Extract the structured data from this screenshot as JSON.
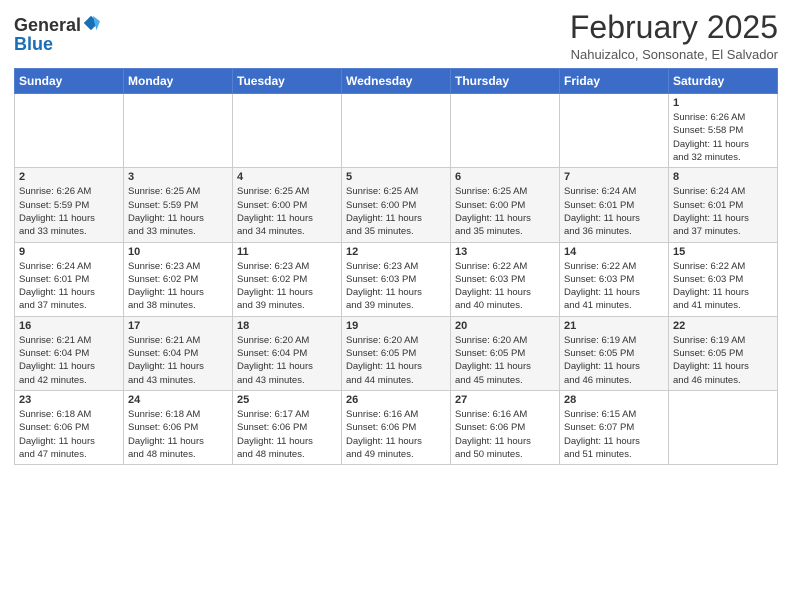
{
  "header": {
    "logo_general": "General",
    "logo_blue": "Blue",
    "month_title": "February 2025",
    "location": "Nahuizalco, Sonsonate, El Salvador"
  },
  "weekdays": [
    "Sunday",
    "Monday",
    "Tuesday",
    "Wednesday",
    "Thursday",
    "Friday",
    "Saturday"
  ],
  "weeks": [
    [
      {
        "day": "",
        "info": ""
      },
      {
        "day": "",
        "info": ""
      },
      {
        "day": "",
        "info": ""
      },
      {
        "day": "",
        "info": ""
      },
      {
        "day": "",
        "info": ""
      },
      {
        "day": "",
        "info": ""
      },
      {
        "day": "1",
        "info": "Sunrise: 6:26 AM\nSunset: 5:58 PM\nDaylight: 11 hours\nand 32 minutes."
      }
    ],
    [
      {
        "day": "2",
        "info": "Sunrise: 6:26 AM\nSunset: 5:59 PM\nDaylight: 11 hours\nand 33 minutes."
      },
      {
        "day": "3",
        "info": "Sunrise: 6:25 AM\nSunset: 5:59 PM\nDaylight: 11 hours\nand 33 minutes."
      },
      {
        "day": "4",
        "info": "Sunrise: 6:25 AM\nSunset: 6:00 PM\nDaylight: 11 hours\nand 34 minutes."
      },
      {
        "day": "5",
        "info": "Sunrise: 6:25 AM\nSunset: 6:00 PM\nDaylight: 11 hours\nand 35 minutes."
      },
      {
        "day": "6",
        "info": "Sunrise: 6:25 AM\nSunset: 6:00 PM\nDaylight: 11 hours\nand 35 minutes."
      },
      {
        "day": "7",
        "info": "Sunrise: 6:24 AM\nSunset: 6:01 PM\nDaylight: 11 hours\nand 36 minutes."
      },
      {
        "day": "8",
        "info": "Sunrise: 6:24 AM\nSunset: 6:01 PM\nDaylight: 11 hours\nand 37 minutes."
      }
    ],
    [
      {
        "day": "9",
        "info": "Sunrise: 6:24 AM\nSunset: 6:01 PM\nDaylight: 11 hours\nand 37 minutes."
      },
      {
        "day": "10",
        "info": "Sunrise: 6:23 AM\nSunset: 6:02 PM\nDaylight: 11 hours\nand 38 minutes."
      },
      {
        "day": "11",
        "info": "Sunrise: 6:23 AM\nSunset: 6:02 PM\nDaylight: 11 hours\nand 39 minutes."
      },
      {
        "day": "12",
        "info": "Sunrise: 6:23 AM\nSunset: 6:03 PM\nDaylight: 11 hours\nand 39 minutes."
      },
      {
        "day": "13",
        "info": "Sunrise: 6:22 AM\nSunset: 6:03 PM\nDaylight: 11 hours\nand 40 minutes."
      },
      {
        "day": "14",
        "info": "Sunrise: 6:22 AM\nSunset: 6:03 PM\nDaylight: 11 hours\nand 41 minutes."
      },
      {
        "day": "15",
        "info": "Sunrise: 6:22 AM\nSunset: 6:03 PM\nDaylight: 11 hours\nand 41 minutes."
      }
    ],
    [
      {
        "day": "16",
        "info": "Sunrise: 6:21 AM\nSunset: 6:04 PM\nDaylight: 11 hours\nand 42 minutes."
      },
      {
        "day": "17",
        "info": "Sunrise: 6:21 AM\nSunset: 6:04 PM\nDaylight: 11 hours\nand 43 minutes."
      },
      {
        "day": "18",
        "info": "Sunrise: 6:20 AM\nSunset: 6:04 PM\nDaylight: 11 hours\nand 43 minutes."
      },
      {
        "day": "19",
        "info": "Sunrise: 6:20 AM\nSunset: 6:05 PM\nDaylight: 11 hours\nand 44 minutes."
      },
      {
        "day": "20",
        "info": "Sunrise: 6:20 AM\nSunset: 6:05 PM\nDaylight: 11 hours\nand 45 minutes."
      },
      {
        "day": "21",
        "info": "Sunrise: 6:19 AM\nSunset: 6:05 PM\nDaylight: 11 hours\nand 46 minutes."
      },
      {
        "day": "22",
        "info": "Sunrise: 6:19 AM\nSunset: 6:05 PM\nDaylight: 11 hours\nand 46 minutes."
      }
    ],
    [
      {
        "day": "23",
        "info": "Sunrise: 6:18 AM\nSunset: 6:06 PM\nDaylight: 11 hours\nand 47 minutes."
      },
      {
        "day": "24",
        "info": "Sunrise: 6:18 AM\nSunset: 6:06 PM\nDaylight: 11 hours\nand 48 minutes."
      },
      {
        "day": "25",
        "info": "Sunrise: 6:17 AM\nSunset: 6:06 PM\nDaylight: 11 hours\nand 48 minutes."
      },
      {
        "day": "26",
        "info": "Sunrise: 6:16 AM\nSunset: 6:06 PM\nDaylight: 11 hours\nand 49 minutes."
      },
      {
        "day": "27",
        "info": "Sunrise: 6:16 AM\nSunset: 6:06 PM\nDaylight: 11 hours\nand 50 minutes."
      },
      {
        "day": "28",
        "info": "Sunrise: 6:15 AM\nSunset: 6:07 PM\nDaylight: 11 hours\nand 51 minutes."
      },
      {
        "day": "",
        "info": ""
      }
    ]
  ]
}
